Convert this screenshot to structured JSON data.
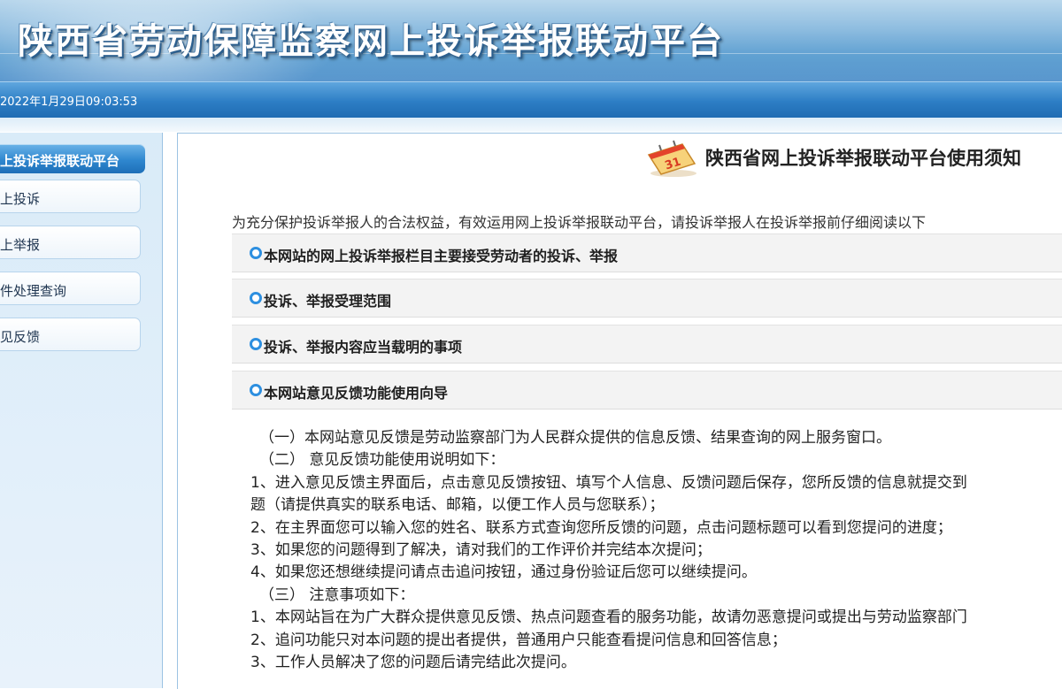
{
  "header": {
    "title": "陕西省劳动保障监察网上投诉举报联动平台",
    "datetime": "2022年1月29日09:03:53"
  },
  "sidebar": {
    "header_label": "上投诉举报联动平台",
    "items": [
      {
        "label": "上投诉"
      },
      {
        "label": "上举报"
      },
      {
        "label": "件处理查询"
      },
      {
        "label": "见反馈"
      }
    ]
  },
  "main": {
    "notice_title": "陕西省网上投诉举报联动平台使用须知",
    "intro": "为充分保护投诉举报人的合法权益，有效运用网上投诉举报联动平台，请投诉举报人在投诉举报前仔细阅读以下",
    "sections": [
      {
        "label": "本网站的网上投诉举报栏目主要接受劳动者的投诉、举报"
      },
      {
        "label": "投诉、举报受理范围"
      },
      {
        "label": "投诉、举报内容应当载明的事项"
      },
      {
        "label": "本网站意见反馈功能使用向导"
      }
    ],
    "guide_lines": [
      "（一）本网站意见反馈是劳动监察部门为人民群众提供的信息反馈、结果查询的网上服务窗口。",
      "（二） 意见反馈功能使用说明如下：",
      "1、进入意见反馈主界面后，点击意见反馈按钮、填写个人信息、反馈问题后保存，您所反馈的信息就提交到",
      "题（请提供真实的联系电话、邮箱，以便工作人员与您联系）；",
      "2、在主界面您可以输入您的姓名、联系方式查询您所反馈的问题，点击问题标题可以看到您提问的进度；",
      "3、如果您的问题得到了解决，请对我们的工作评价并完结本次提问；",
      "4、如果您还想继续提问请点击追问按钮，通过身份验证后您可以继续提问。",
      "（三） 注意事项如下：",
      "1、本网站旨在为广大群众提供意见反馈、热点问题查看的服务功能，故请勿恶意提问或提出与劳动监察部门",
      "2、追问功能只对本问题的提出者提供，普通用户只能查看提问信息和回答信息；",
      "3、工作人员解决了您的问题后请完结此次提问。"
    ]
  },
  "colors": {
    "banner_blue": "#3f86c6",
    "datebar_blue": "#2d7ec5",
    "accordion_dot": "#2d8fe0"
  },
  "icons": {
    "notice": "calendar-notice-icon",
    "section_bullet": "radio-bullet-icon"
  }
}
